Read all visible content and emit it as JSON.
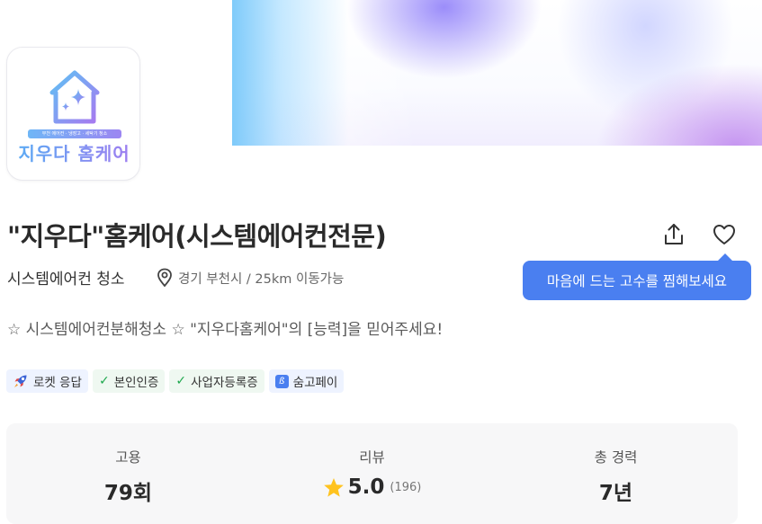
{
  "profile": {
    "logo": {
      "strip_text": "부천 에어컨 · 냉장고 · 세탁기 청소",
      "title": "지우다 홈케어"
    },
    "title": "\"지우다\"홈케어(시스템에어컨전문)",
    "category": "시스템에어컨 청소",
    "location": "경기 부천시 / 25km 이동가능",
    "intro": "☆ 시스템에어컨분해청소 ☆ \"지우다홈케어\"의 [능력]을 믿어주세요!"
  },
  "tooltip": {
    "text": "마음에 드는 고수를 찜해보세요"
  },
  "badges": [
    {
      "label": "로켓 응답",
      "icon": "rocket-icon"
    },
    {
      "label": "본인인증",
      "icon": "check-icon"
    },
    {
      "label": "사업자등록증",
      "icon": "check-icon"
    },
    {
      "label": "숨고페이",
      "icon": "pay-icon"
    }
  ],
  "stats": {
    "hires": {
      "label": "고용",
      "value": "79회"
    },
    "reviews": {
      "label": "리뷰",
      "value": "5.0",
      "count": "(196)"
    },
    "career": {
      "label": "총 경력",
      "value": "7년"
    }
  },
  "colors": {
    "accent": "#4a7ff0",
    "star": "#ffc31f",
    "check": "#1fa84e"
  }
}
